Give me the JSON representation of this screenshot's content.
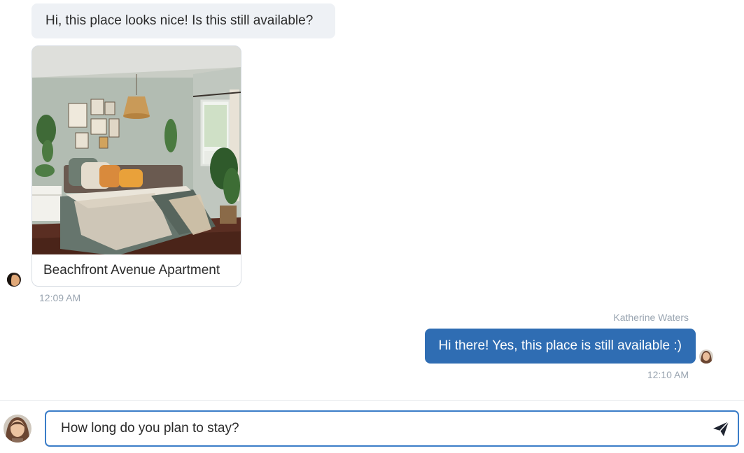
{
  "conversation": {
    "incoming": {
      "message": "Hi, this place looks nice! Is this still available?",
      "listing_title": "Beachfront Avenue Apartment",
      "time": "12:09 AM"
    },
    "outgoing": {
      "sender": "Katherine Waters",
      "message": "Hi there! Yes, this place is still available :)",
      "time": "12:10 AM"
    }
  },
  "composer": {
    "value": "How long do you plan to stay?"
  },
  "icons": {
    "send": "send-icon (paper plane)",
    "listing_photo": "bedroom-photo"
  },
  "colors": {
    "outgoing_bubble": "#2f6db3",
    "incoming_bubble": "#eef1f5",
    "input_border": "#3b7dc8",
    "timestamp": "#9aa5b1"
  }
}
